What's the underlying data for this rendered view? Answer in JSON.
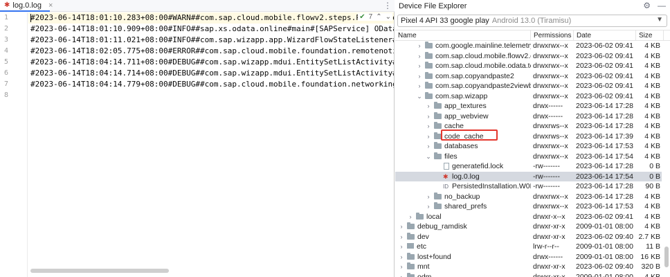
{
  "editor": {
    "tab_label": "log.0.log",
    "inspection_count": "7",
    "lines": [
      "#2023-06-14T18:01:10.283+08:00#WARN##com.sap.cloud.mobile.flowv2.steps.PostRestore",
      "#2023-06-14T18:01:10.909+08:00#INFO##sap.xs.odata.online#main#[SAPService] OData framework v",
      "#2023-06-14T18:01:11.021+08:00#INFO##com.sap.wizapp.app.WizardFlowStateListener#main#Default",
      "#2023-06-14T18:02:05.775+08:00#ERROR##com.sap.cloud.mobile.foundation.remotenotification.Fir",
      "#2023-06-14T18:04:14.711+08:00#DEBUG##com.sap.wizapp.mdui.EntitySetListActivity#main#onOptio",
      "#2023-06-14T18:04:14.714+08:00#DEBUG##com.sap.wizapp.mdui.EntitySetListActivity#main#setting",
      "#2023-06-14T18:04:14.779+08:00#DEBUG##com.sap.cloud.mobile.foundation.networking.CsrfTokenIn",
      ""
    ],
    "line_numbers": [
      "1",
      "2",
      "3",
      "4",
      "5",
      "6",
      "7",
      "8"
    ]
  },
  "explorer": {
    "title": "Device File Explorer",
    "device": "Pixel 4 API 33 google play",
    "device_sub": "Android 13.0 (Tiramisu)",
    "columns": [
      "Name",
      "Permissions",
      "Date",
      "Size"
    ],
    "rows": [
      {
        "name": "com.google.mainline.telemetry",
        "perm": "drwxrwx--x",
        "date": "2023-06-02 09:41",
        "size": "4 KB",
        "icon": "folder",
        "depth": 2,
        "chev": ">"
      },
      {
        "name": "com.sap.cloud.mobile.flowv2.de",
        "perm": "drwxrwx--x",
        "date": "2023-06-02 09:41",
        "size": "4 KB",
        "icon": "folder",
        "depth": 2,
        "chev": ">"
      },
      {
        "name": "com.sap.cloud.mobile.odata.tes",
        "perm": "drwxrwx--x",
        "date": "2023-06-02 09:41",
        "size": "4 KB",
        "icon": "folder",
        "depth": 2,
        "chev": ">"
      },
      {
        "name": "com.sap.copyandpaste2",
        "perm": "drwxrwx--x",
        "date": "2023-06-02 09:41",
        "size": "4 KB",
        "icon": "folder",
        "depth": 2,
        "chev": ">"
      },
      {
        "name": "com.sap.copyandpaste2viewbas",
        "perm": "drwxrwx--x",
        "date": "2023-06-02 09:41",
        "size": "4 KB",
        "icon": "folder",
        "depth": 2,
        "chev": ">"
      },
      {
        "name": "com.sap.wizapp",
        "perm": "drwxrwx--x",
        "date": "2023-06-02 09:41",
        "size": "4 KB",
        "icon": "folder",
        "depth": 2,
        "chev": "v"
      },
      {
        "name": "app_textures",
        "perm": "drwx------",
        "date": "2023-06-14 17:28",
        "size": "4 KB",
        "icon": "folder",
        "depth": 3,
        "chev": ">"
      },
      {
        "name": "app_webview",
        "perm": "drwx------",
        "date": "2023-06-14 17:28",
        "size": "4 KB",
        "icon": "folder",
        "depth": 3,
        "chev": ">"
      },
      {
        "name": "cache",
        "perm": "drwxrws--x",
        "date": "2023-06-14 17:28",
        "size": "4 KB",
        "icon": "folder",
        "depth": 3,
        "chev": ">"
      },
      {
        "name": "code_cache",
        "perm": "drwxrws--x",
        "date": "2023-06-14 17:39",
        "size": "4 KB",
        "icon": "folder",
        "depth": 3,
        "chev": ">"
      },
      {
        "name": "databases",
        "perm": "drwxrwx--x",
        "date": "2023-06-14 17:53",
        "size": "4 KB",
        "icon": "folder",
        "depth": 3,
        "chev": ">"
      },
      {
        "name": "files",
        "perm": "drwxrwx--x",
        "date": "2023-06-14 17:54",
        "size": "4 KB",
        "icon": "folder",
        "depth": 3,
        "chev": "v"
      },
      {
        "name": "generatefid.lock",
        "perm": "-rw-------",
        "date": "2023-06-14 17:28",
        "size": "0 B",
        "icon": "file",
        "depth": 4,
        "chev": ""
      },
      {
        "name": "log.0.log",
        "perm": "-rw-------",
        "date": "2023-06-14 17:54",
        "size": "0 B",
        "icon": "bug",
        "depth": 4,
        "chev": "",
        "selected": true
      },
      {
        "name": "PersistedInstallation.W0RI",
        "perm": "-rw-------",
        "date": "2023-06-14 17:28",
        "size": "90 B",
        "icon": "id",
        "depth": 4,
        "chev": ""
      },
      {
        "name": "no_backup",
        "perm": "drwxrwx--x",
        "date": "2023-06-14 17:28",
        "size": "4 KB",
        "icon": "folder",
        "depth": 3,
        "chev": ">"
      },
      {
        "name": "shared_prefs",
        "perm": "drwxrwx--x",
        "date": "2023-06-14 17:53",
        "size": "4 KB",
        "icon": "folder",
        "depth": 3,
        "chev": ">"
      },
      {
        "name": "local",
        "perm": "drwxr-x--x",
        "date": "2023-06-02 09:41",
        "size": "4 KB",
        "icon": "folder",
        "depth": 1,
        "chev": ">"
      },
      {
        "name": "debug_ramdisk",
        "perm": "drwxr-xr-x",
        "date": "2009-01-01 08:00",
        "size": "4 KB",
        "icon": "folder",
        "depth": 0,
        "chev": ">"
      },
      {
        "name": "dev",
        "perm": "drwxr-xr-x",
        "date": "2023-06-02 09:40",
        "size": "2.7 KB",
        "icon": "folder",
        "depth": 0,
        "chev": ">"
      },
      {
        "name": "etc",
        "perm": "lrw-r--r--",
        "date": "2009-01-01 08:00",
        "size": "11 B",
        "icon": "link",
        "depth": 0,
        "chev": ">"
      },
      {
        "name": "lost+found",
        "perm": "drwx------",
        "date": "2009-01-01 08:00",
        "size": "16 KB",
        "icon": "folder",
        "depth": 0,
        "chev": ">"
      },
      {
        "name": "mnt",
        "perm": "drwxr-xr-x",
        "date": "2023-06-02 09:40",
        "size": "320 B",
        "icon": "folder",
        "depth": 0,
        "chev": ">"
      },
      {
        "name": "odm",
        "perm": "drwxr-xr-x",
        "date": "2009-01-01 08:00",
        "size": "4 KB",
        "icon": "folder",
        "depth": 0,
        "chev": ">"
      }
    ]
  },
  "colors": {
    "accent": "#3574f0",
    "selection": "#d5d9e0",
    "highlight": "#e4372e",
    "error": "#d03a2f"
  }
}
